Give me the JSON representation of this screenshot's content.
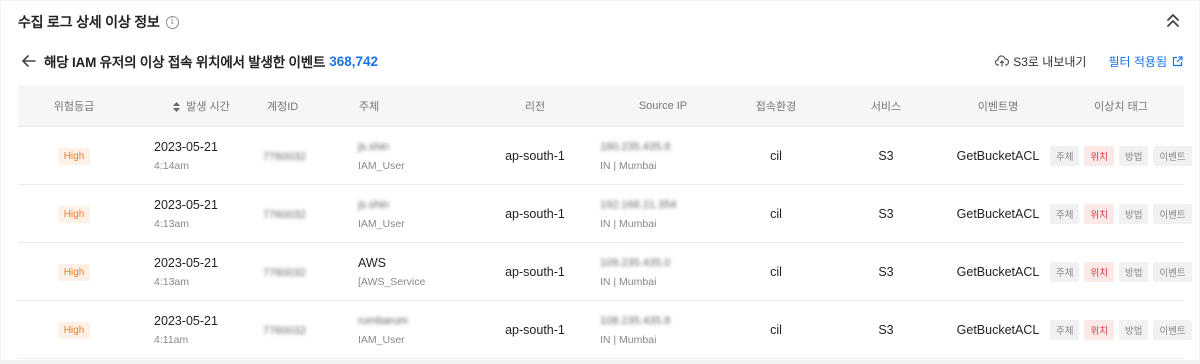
{
  "header": {
    "title": "수집 로그 상세 이상 정보",
    "info_glyph": "i"
  },
  "subbar": {
    "title": "해당 IAM 유저의 이상 접속 위치에서 발생한 이벤트",
    "count": "368,742",
    "export_label": "S3로 내보내기",
    "filter_label": "필터 적용됨"
  },
  "table": {
    "columns": [
      "위험등급",
      "발생 시간",
      "계정ID",
      "주체",
      "리전",
      "Source IP",
      "접속환경",
      "서비스",
      "이벤트명",
      "이상치 태그"
    ],
    "rows": [
      {
        "risk": "High",
        "date": "2023-05-21",
        "time": "4:14am",
        "account": "7760032",
        "actor_name": "js.shin",
        "actor_type": "IAM_User",
        "region": "ap-south-1",
        "ip": "180.235.435.8",
        "location": "IN | Mumbai",
        "env": "cil",
        "service": "S3",
        "event": "GetBucketACL",
        "tags": [
          "주체",
          "위치",
          "방법",
          "이벤트"
        ]
      },
      {
        "risk": "High",
        "date": "2023-05-21",
        "time": "4:13am",
        "account": "7760032",
        "actor_name": "js.shin",
        "actor_type": "IAM_User",
        "region": "ap-south-1",
        "ip": "192.168.21.354",
        "location": "IN | Mumbai",
        "env": "cil",
        "service": "S3",
        "event": "GetBucketACL",
        "tags": [
          "주체",
          "위치",
          "방법",
          "이벤트"
        ]
      },
      {
        "risk": "High",
        "date": "2023-05-21",
        "time": "4:13am",
        "account": "7760032",
        "actor_name": "AWS",
        "actor_type": "[AWS_Service",
        "region": "ap-south-1",
        "ip": "109.235.435.0",
        "location": "IN | Mumbai",
        "env": "cil",
        "service": "S3",
        "event": "GetBucketACL",
        "tags": [
          "주체",
          "위치",
          "방법",
          "이벤트"
        ]
      },
      {
        "risk": "High",
        "date": "2023-05-21",
        "time": "4:11am",
        "account": "7760032",
        "actor_name": "rumbarum",
        "actor_type": "IAM_User",
        "region": "ap-south-1",
        "ip": "108.235.435.8",
        "location": "IN | Mumbai",
        "env": "cil",
        "service": "S3",
        "event": "GetBucketACL",
        "tags": [
          "주체",
          "위치",
          "방법",
          "이벤트"
        ]
      }
    ],
    "active_tag": "위치"
  },
  "icons": {
    "info": "info-icon",
    "collapse": "chevron-double-up-icon",
    "back": "arrow-left-icon",
    "export": "cloud-upload-icon",
    "filter": "external-link-icon",
    "sort": "sort-icon"
  },
  "colors": {
    "accent": "#1a73e8",
    "risk_high_text": "#f07b2e",
    "risk_high_bg": "#fff1e6",
    "tag_active_text": "#d43d3d",
    "tag_active_bg": "#fde8e8"
  }
}
